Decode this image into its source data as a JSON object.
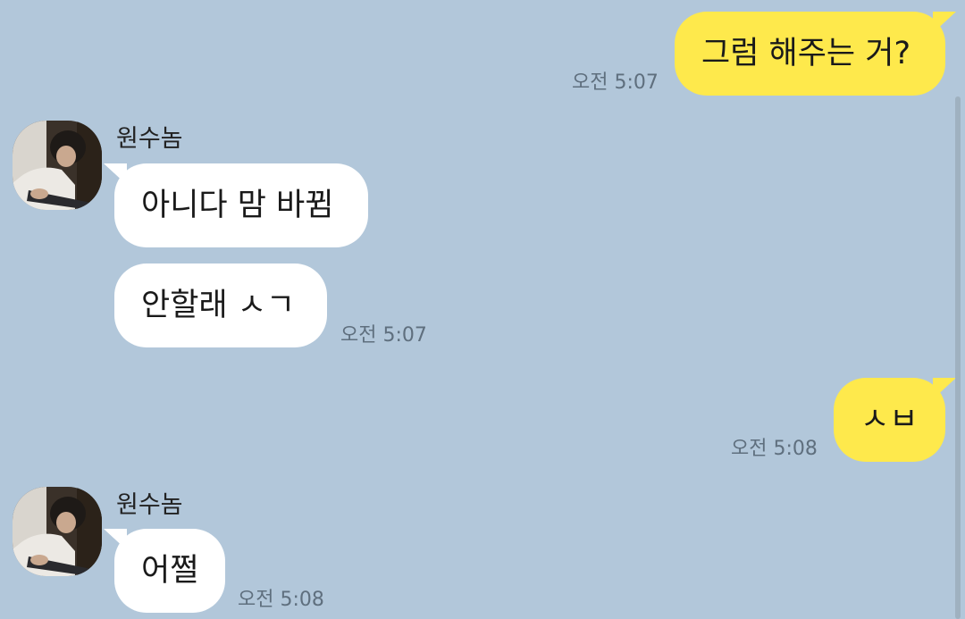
{
  "colors": {
    "background": "#b2c7da",
    "my_bubble": "#fee94c",
    "their_bubble": "#ffffff",
    "timestamp": "#5f6f7e",
    "scrollbar": "#9fb1c0"
  },
  "messages": [
    {
      "sender": "me",
      "text": "그럼 해주는 거?",
      "time": "오전 5:07"
    },
    {
      "sender": "contact",
      "name": "원수놈",
      "avatar_icon": "profile-photo-guitar",
      "texts": [
        "아니다 맘 바뀜",
        "안할래 ㅅㄱ"
      ],
      "time": "오전 5:07"
    },
    {
      "sender": "me",
      "text": "ㅅㅂ",
      "time": "오전 5:08"
    },
    {
      "sender": "contact",
      "name": "원수놈",
      "avatar_icon": "profile-photo-guitar",
      "texts": [
        "어쩔"
      ],
      "time": "오전 5:08"
    }
  ]
}
